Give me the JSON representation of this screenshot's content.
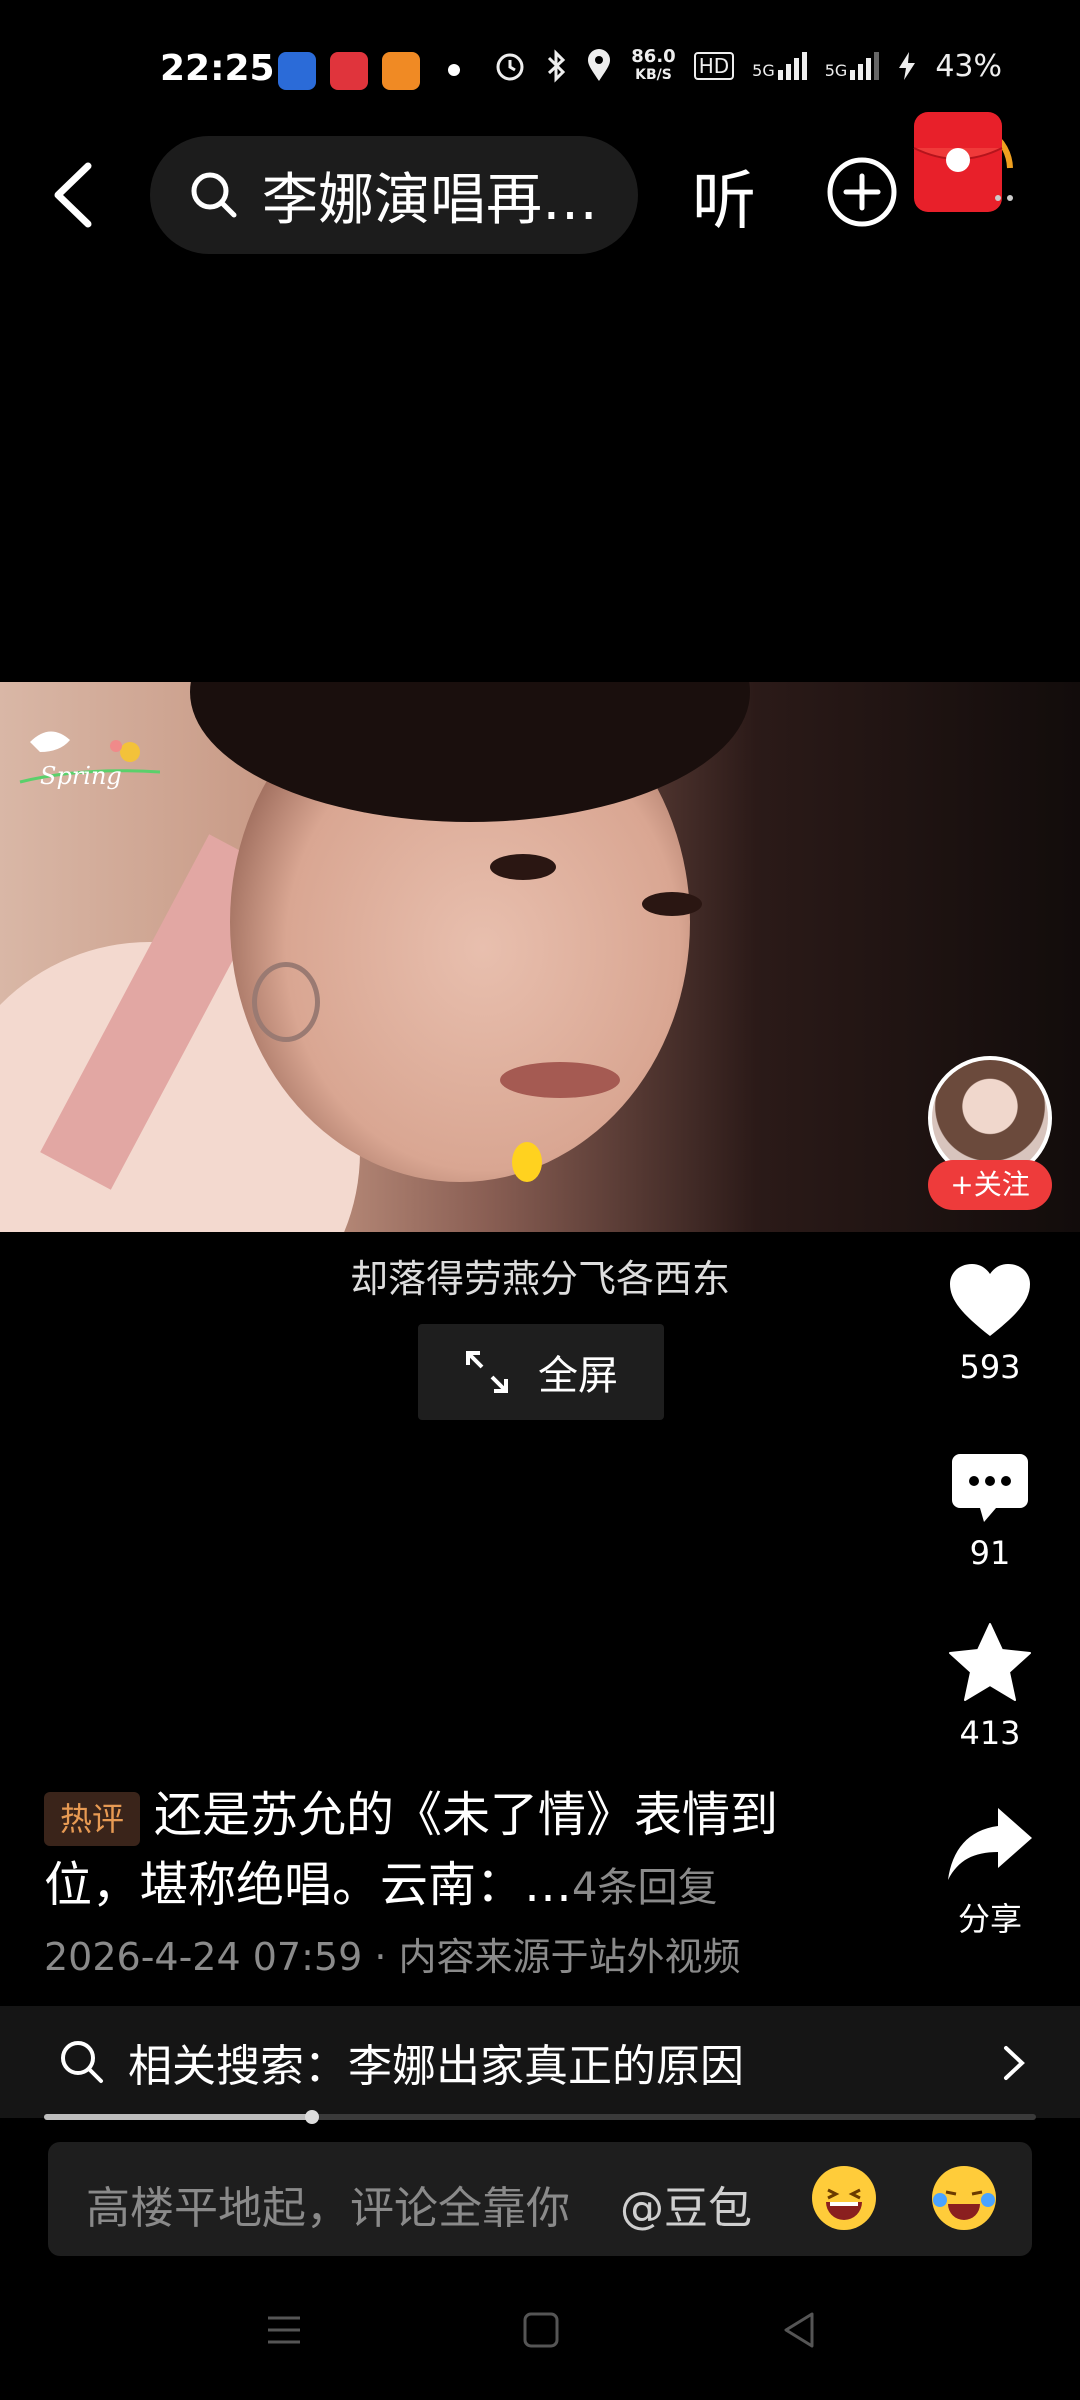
{
  "status_bar": {
    "time": "22:25",
    "net_speed_top": "86.0",
    "net_speed_bottom": "KB/S",
    "hd": "HD",
    "signal1": "5G",
    "signal2": "5G",
    "battery": "43%"
  },
  "top_bar": {
    "search_text": "李娜演唱再…",
    "listen_label": "听"
  },
  "video": {
    "watermark": "Spring",
    "subtitle": "却落得劳燕分飞各西东",
    "fullscreen_label": "全屏"
  },
  "rail": {
    "follow_label": "+关注",
    "likes": "593",
    "comments": "91",
    "favorites": "413",
    "share_label": "分享"
  },
  "description": {
    "badge": "热评",
    "text": "还是苏允的《未了情》表情到位，堪称绝唱。云南：",
    "more": "…",
    "replies": "4条回复",
    "meta": "2026-4-24 07:59 · 内容来源于站外视频"
  },
  "related": {
    "label": "相关搜索：李娜出家真正的原因"
  },
  "progress": {
    "played_fraction": 0.27
  },
  "comment": {
    "placeholder": "高楼平地起，评论全靠你",
    "mention": "@豆包"
  }
}
